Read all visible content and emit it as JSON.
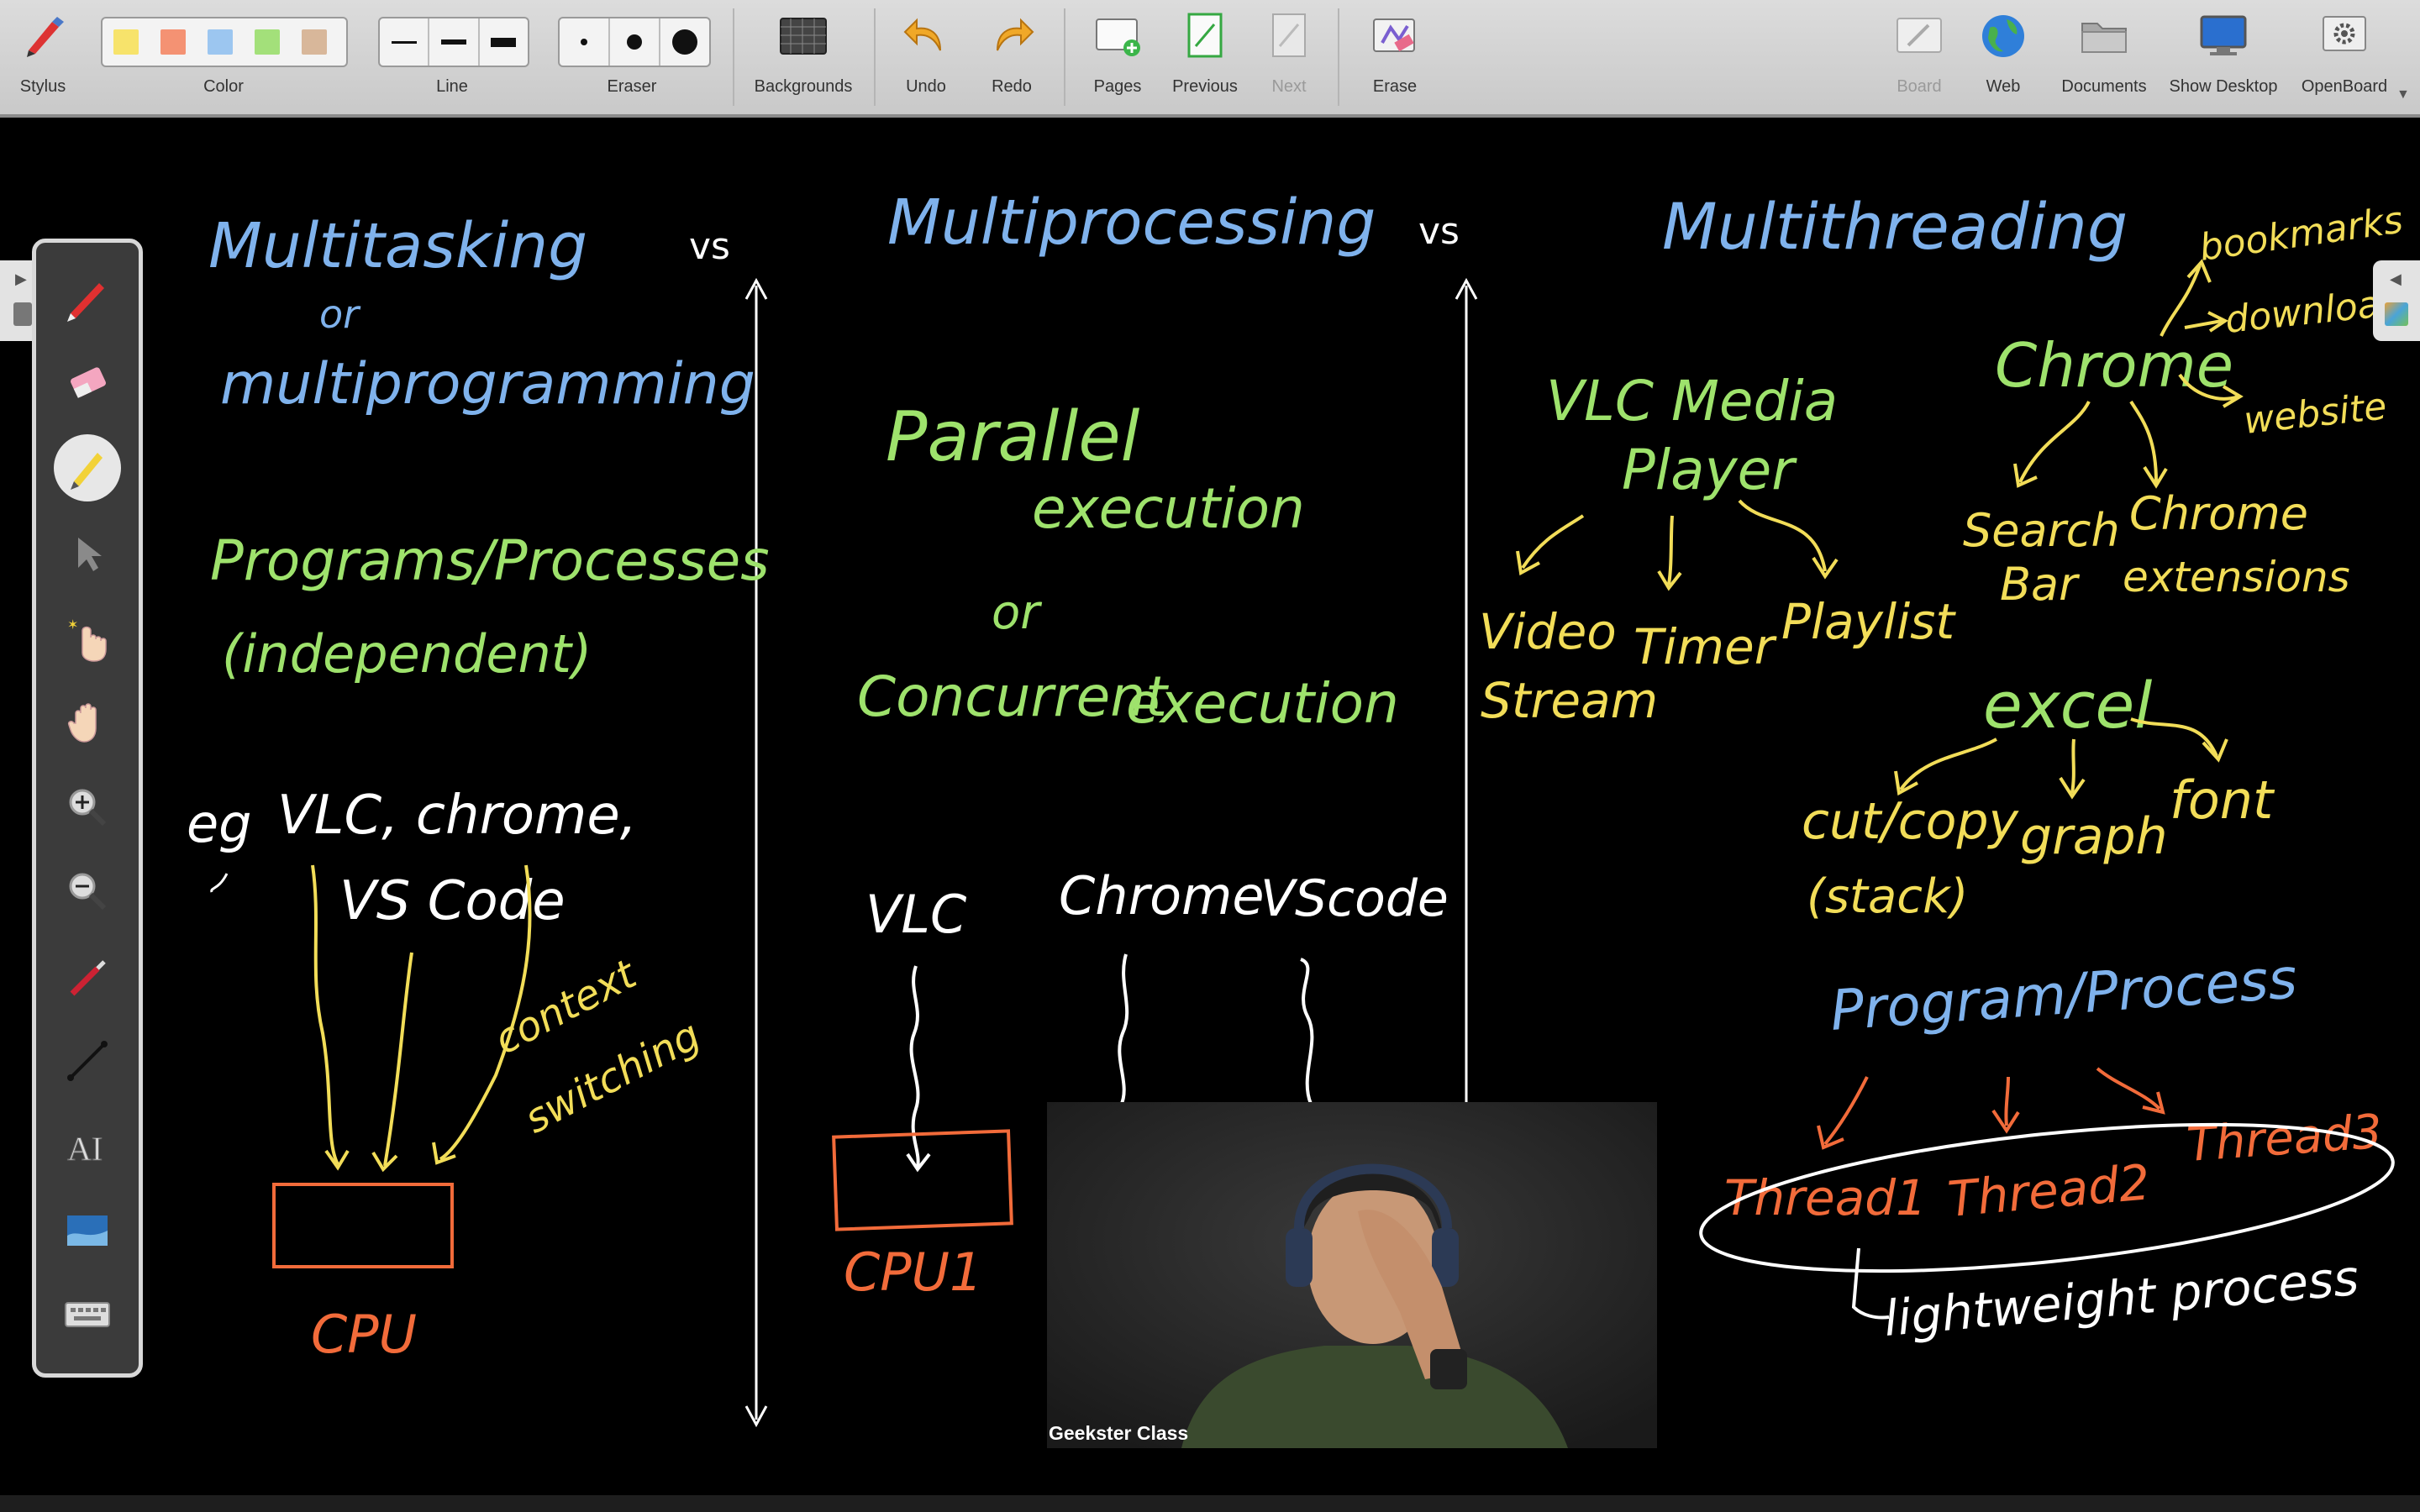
{
  "toolbar": {
    "stylus_label": "Stylus",
    "color_label": "Color",
    "line_label": "Line",
    "eraser_label": "Eraser",
    "backgrounds_label": "Backgrounds",
    "undo_label": "Undo",
    "redo_label": "Redo",
    "pages_label": "Pages",
    "previous_label": "Previous",
    "next_label": "Next",
    "erase_label": "Erase",
    "board_label": "Board",
    "web_label": "Web",
    "documents_label": "Documents",
    "show_desktop_label": "Show Desktop",
    "openboard_label": "OpenBoard",
    "colors": [
      "#f7e36b",
      "#f49273",
      "#9cc6f0",
      "#a3e07a",
      "#d8b79a"
    ]
  },
  "board": {
    "vs_left": "vs",
    "vs_right": "vs",
    "col1": {
      "title": "Multitasking",
      "or": "or",
      "subtitle": "multiprogramming",
      "programs": "Programs/Processes",
      "independent": "(independent)",
      "eg": "eg",
      "apps_line1": "VLC, chrome,",
      "apps_line2": "VS Code",
      "context_line1": "context",
      "context_line2": "switching",
      "cpu": "CPU"
    },
    "col2": {
      "title": "Multiprocessing",
      "parallel": "Parallel",
      "execution": "execution",
      "or": "or",
      "concurrent": "Concurrent",
      "execution2": "execution",
      "vlc": "VLC",
      "chrome": "Chrome",
      "vscode": "VScode",
      "cpu1": "CPU1"
    },
    "col3": {
      "title": "Multithreading",
      "vlc_line1": "VLC Media",
      "vlc_line2": "Player",
      "video_line1": "Video",
      "video_line2": "Stream",
      "timer": "Timer",
      "playlist": "Playlist",
      "chrome": "Chrome",
      "bookmarks": "bookmarks",
      "downloads": "downloads",
      "website": "website",
      "search_line1": "Search",
      "search_line2": "Bar",
      "ext_line1": "Chrome",
      "ext_line2": "extensions",
      "excel": "excel",
      "cut_line1": "cut/copy",
      "cut_line2": "(stack)",
      "graph": "graph",
      "font": "font",
      "program": "Program/Process",
      "thread1": "Thread1",
      "thread2": "Thread2",
      "thread3": "Thread3",
      "lightweight": "lightweight process"
    }
  },
  "webcam": {
    "name": "Geekster Class"
  },
  "ink_colors": {
    "blue": "#7fb2ec",
    "green": "#9ee26c",
    "yellow": "#f2dd58",
    "white": "#ffffff",
    "red": "#f26b3a"
  }
}
